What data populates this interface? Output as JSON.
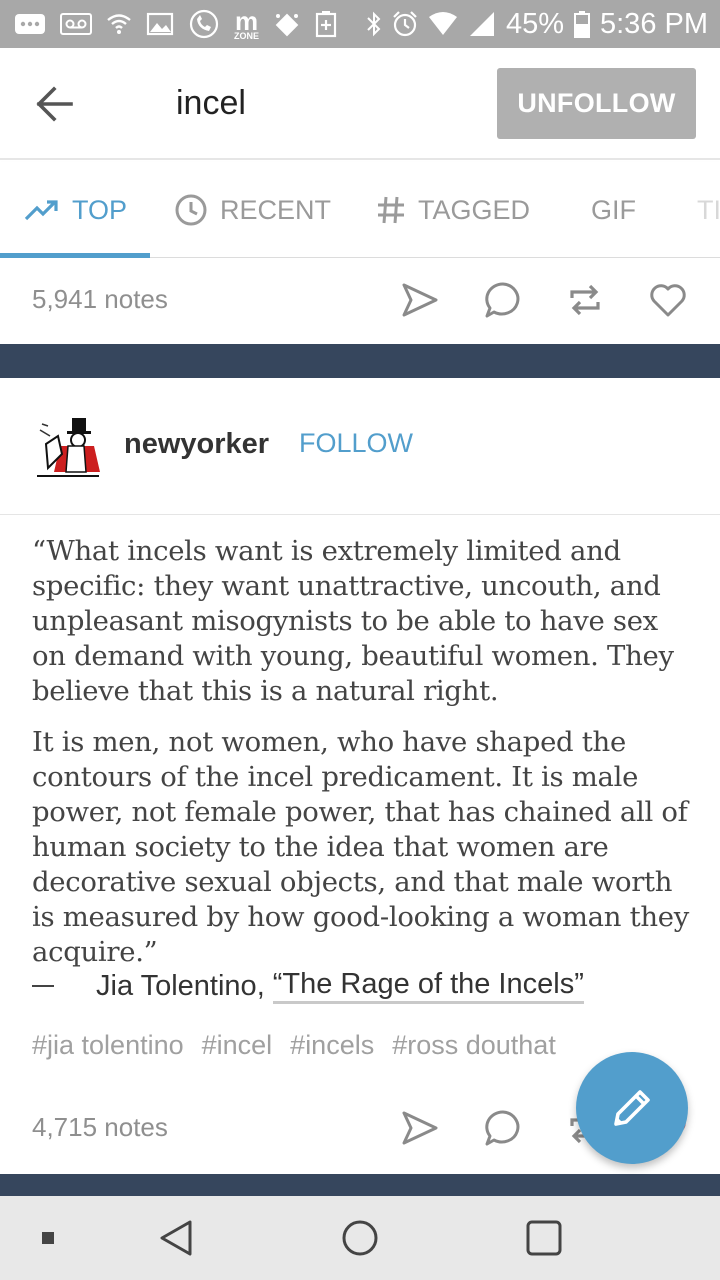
{
  "status_bar": {
    "battery": "45%",
    "time": "5:36 PM",
    "icons": [
      "more-icon",
      "voicemail-icon",
      "wifi-icon",
      "image-icon",
      "call-icon",
      "m-zone-icon",
      "download-icon",
      "add-icon",
      "bluetooth-icon",
      "alarm-icon",
      "wifi-signal-icon",
      "cell-signal-icon",
      "battery-icon"
    ],
    "m_zone_label": "m",
    "zone_label": "ZONE"
  },
  "header": {
    "search_term": "incel",
    "unfollow_label": "UNFOLLOW"
  },
  "tabs": [
    {
      "label": "TOP",
      "icon": "trending-icon",
      "active": true
    },
    {
      "label": "RECENT",
      "icon": "clock-icon",
      "active": false
    },
    {
      "label": "TAGGED",
      "icon": "hash-icon",
      "active": false
    },
    {
      "label": "GIF",
      "icon": "",
      "active": false
    },
    {
      "label": "TI",
      "icon": "",
      "active": false
    }
  ],
  "prev_post": {
    "notes": "5,941 notes"
  },
  "post": {
    "blog_name": "newyorker",
    "follow_label": "FOLLOW",
    "quote_p1": "“What incels want is extremely limited and specific: they want unattractive, uncouth, and unpleasant misogynists to be able to have sex on demand with young, beautiful women. They believe that this is a natural right.",
    "quote_p2": "It is men, not women, who have shaped the con­tours of the incel predicament. It is male power, not female power, that has chained all of human society to the idea that women are decorative sexual objects, and that male worth is measured by how good-looking a woman they acquire.”",
    "source_author": "Jia Tolentino,",
    "source_title": "“The Rage of the Incels”",
    "tags": [
      "#jia tolentino",
      "#incel",
      "#incels",
      "#ross douthat"
    ],
    "notes": "4,715 notes"
  },
  "colors": {
    "accent": "#529ecc",
    "dark_band": "#36465d",
    "status_bar": "#a8a8a8",
    "unfollow_bg": "#b0b0b0"
  }
}
